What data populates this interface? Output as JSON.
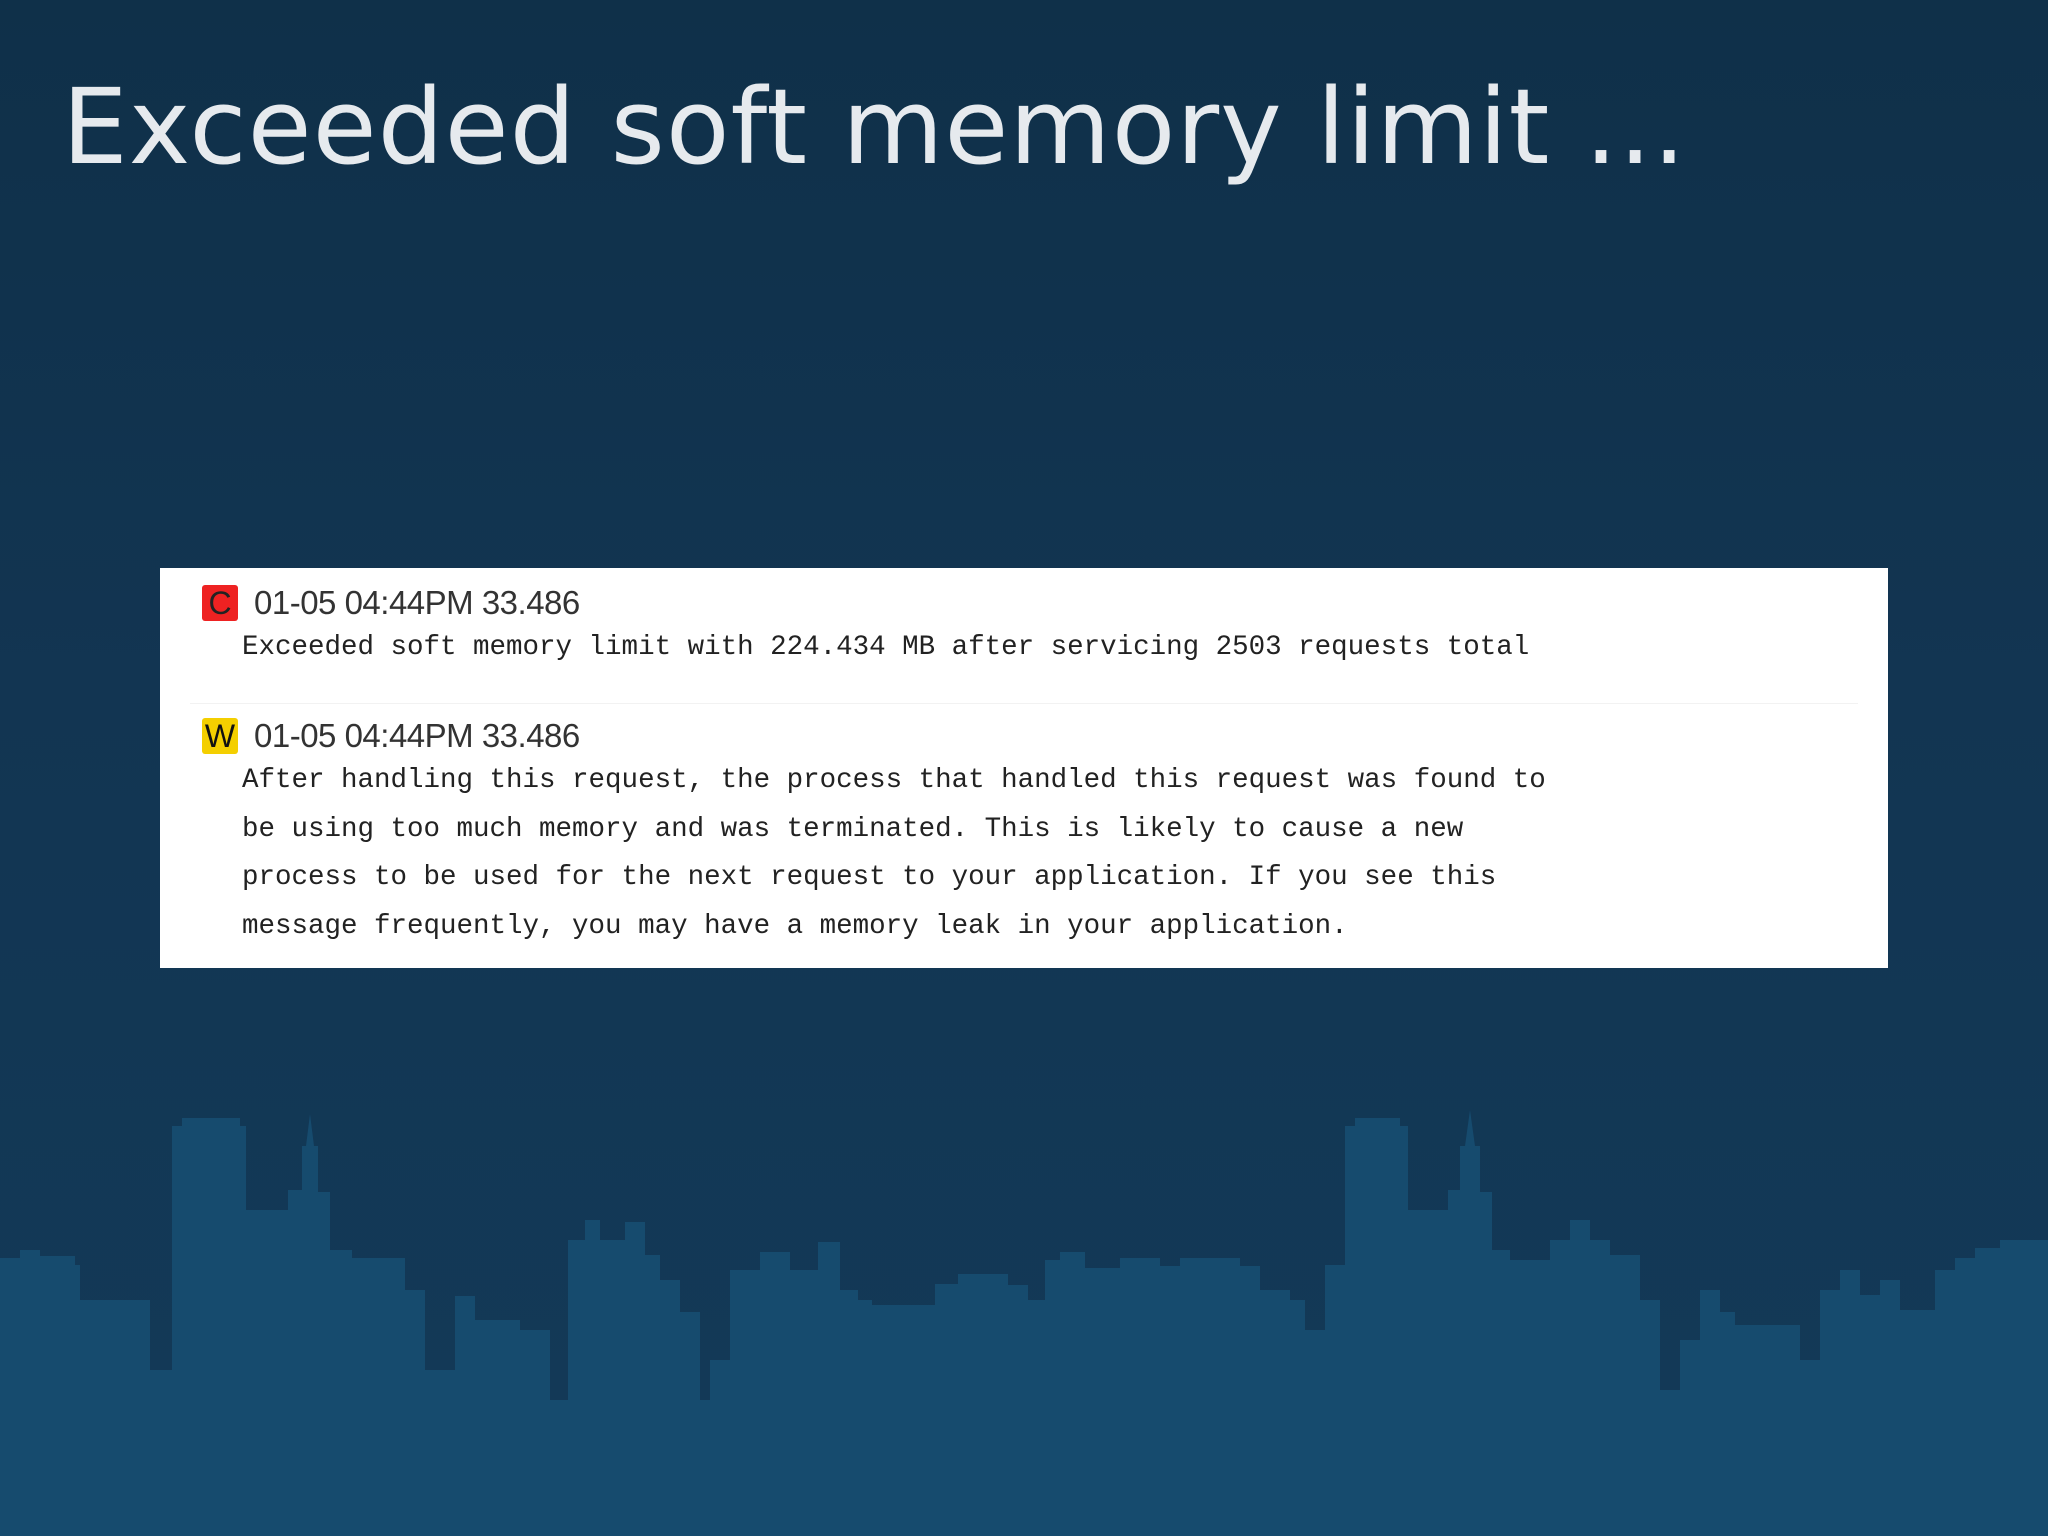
{
  "slide": {
    "title": "Exceeded soft memory limit ..."
  },
  "log": {
    "entries": [
      {
        "severity": "C",
        "timestamp": "01-05 04:44PM 33.486",
        "message_lines": [
          "Exceeded soft memory limit with 224.434 MB after servicing 2503 requests total"
        ]
      },
      {
        "severity": "W",
        "timestamp": "01-05 04:44PM 33.486",
        "message_lines": [
          "After handling this request, the process that handled this request was found to",
          "be using too much memory and was terminated. This is likely to cause a new",
          "process to be used for the next request to your application. If you see this",
          "message frequently, you may have a memory leak in your application."
        ]
      }
    ]
  },
  "colors": {
    "background": "#123552",
    "skyline": "#164b6e",
    "critical_badge": "#ee2222",
    "warning_badge": "#f4cf00",
    "title_text": "#e6eaee"
  },
  "icons": {
    "critical": "critical-severity-icon",
    "warning": "warning-severity-icon"
  }
}
